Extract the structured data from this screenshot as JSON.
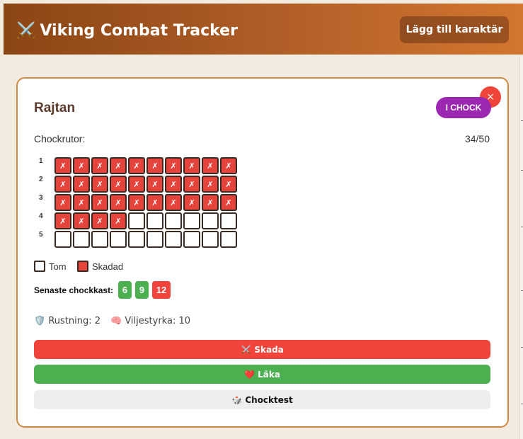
{
  "app": {
    "title": "Viking Combat Tracker",
    "title_icon": "⚔️",
    "add_button": "Lägg till karaktär"
  },
  "character": {
    "name": "Rajtan",
    "status_badge": "I CHOCK",
    "close_symbol": "×",
    "shock_label": "Chockrutor:",
    "shock_count": "34/50",
    "hit_mark": "✗",
    "rows": [
      {
        "label": "1",
        "cells": [
          1,
          1,
          1,
          1,
          1,
          1,
          1,
          1,
          1,
          1
        ]
      },
      {
        "label": "2",
        "cells": [
          1,
          1,
          1,
          1,
          1,
          1,
          1,
          1,
          1,
          1
        ]
      },
      {
        "label": "3",
        "cells": [
          1,
          1,
          1,
          1,
          1,
          1,
          1,
          1,
          1,
          1
        ]
      },
      {
        "label": "4",
        "cells": [
          1,
          1,
          1,
          1,
          0,
          0,
          0,
          0,
          0,
          0
        ]
      },
      {
        "label": "5",
        "cells": [
          0,
          0,
          0,
          0,
          0,
          0,
          0,
          0,
          0,
          0
        ]
      }
    ],
    "legend": {
      "empty": "Tom",
      "damaged": "Skadad"
    },
    "rolls_label": "Senaste chockkast:",
    "rolls": [
      {
        "value": "6",
        "color": "#4caf50"
      },
      {
        "value": "9",
        "color": "#4caf50"
      },
      {
        "value": "12",
        "color": "#f0443c"
      }
    ],
    "armor": {
      "icon": "🛡️",
      "text": "Rustning: 2"
    },
    "willpower": {
      "icon": "🧠",
      "text": "Viljestyrka: 10"
    }
  },
  "actions": {
    "damage": "⚔️ Skada",
    "heal": "❤️ Läka",
    "test": "🎲 Chocktest"
  },
  "colors": {
    "header_start": "#8b4513",
    "header_end": "#d2762f",
    "badge": "#9c27b0",
    "hit": "#e5443c",
    "card_border": "#cd8a45"
  }
}
